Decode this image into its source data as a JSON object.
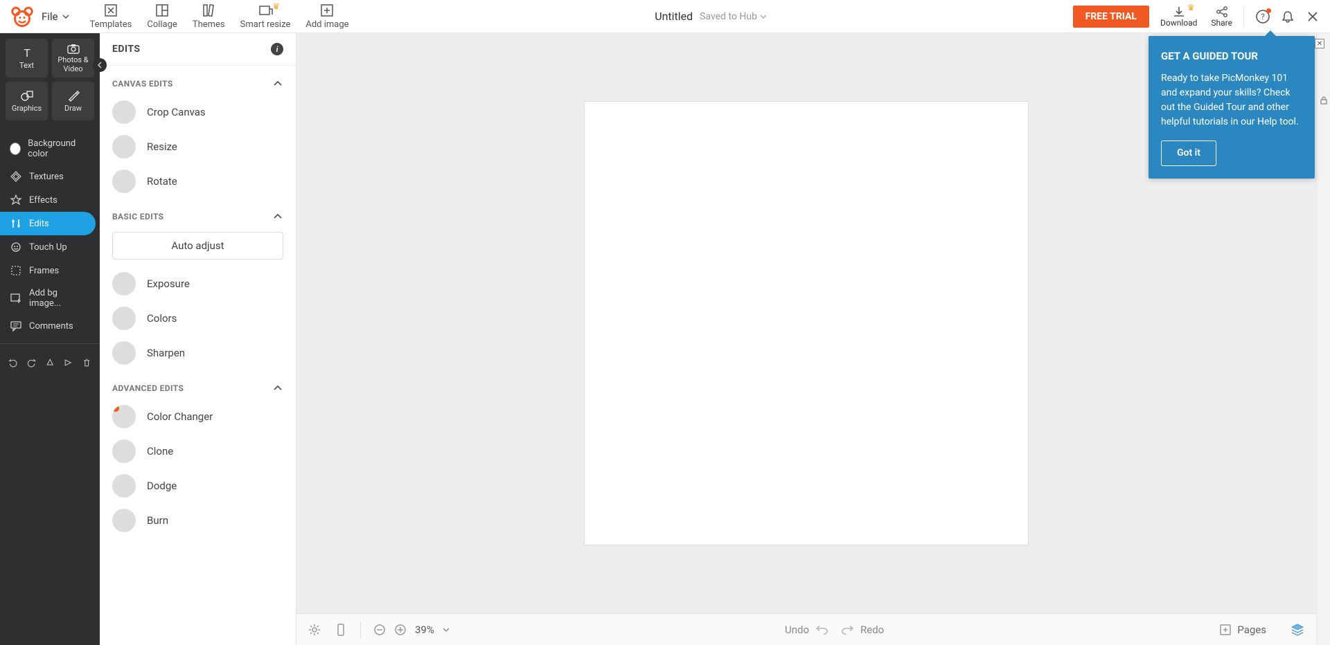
{
  "header": {
    "file_menu": "File",
    "tools": {
      "templates": "Templates",
      "collage": "Collage",
      "themes": "Themes",
      "smart_resize": "Smart resize",
      "add_image": "Add image"
    },
    "doc_title": "Untitled",
    "doc_status": "Saved to Hub",
    "trial_btn": "FREE TRIAL",
    "download": "Download",
    "share": "Share"
  },
  "dark_sidebar": {
    "tabs": {
      "text": "Text",
      "photos": "Photos & Video",
      "graphics": "Graphics",
      "draw": "Draw"
    },
    "items": {
      "bg_color": "Background color",
      "textures": "Textures",
      "effects": "Effects",
      "edits": "Edits",
      "touch_up": "Touch Up",
      "frames": "Frames",
      "add_bg": "Add bg image...",
      "comments": "Comments"
    }
  },
  "panel": {
    "title": "EDITS",
    "sections": {
      "canvas": "CANVAS EDITS",
      "basic": "BASIC EDITS",
      "advanced": "ADVANCED EDITS"
    },
    "canvas_items": {
      "crop": "Crop Canvas",
      "resize": "Resize",
      "rotate": "Rotate"
    },
    "basic_items": {
      "auto": "Auto adjust",
      "exposure": "Exposure",
      "colors": "Colors",
      "sharpen": "Sharpen"
    },
    "advanced_items": {
      "color_changer": "Color Changer",
      "clone": "Clone",
      "dodge": "Dodge",
      "burn": "Burn"
    }
  },
  "footer": {
    "zoom": "39%",
    "undo": "Undo",
    "redo": "Redo",
    "pages": "Pages"
  },
  "tour": {
    "title": "GET A GUIDED TOUR",
    "body": "Ready to take PicMonkey 101 and expand your skills? Check out the Guided Tour and other helpful tutorials in our Help tool.",
    "button": "Got it"
  }
}
